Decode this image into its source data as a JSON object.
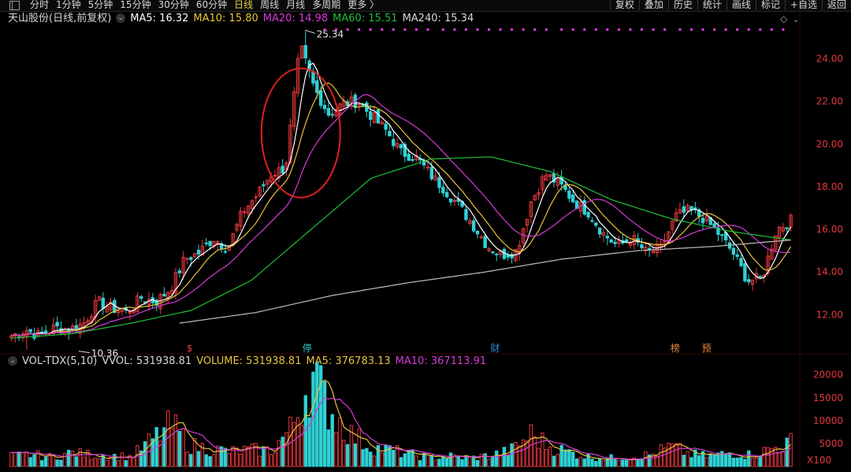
{
  "toolbar": {
    "periods": [
      {
        "label": "分时",
        "active": false
      },
      {
        "label": "1分钟",
        "active": false
      },
      {
        "label": "5分钟",
        "active": false
      },
      {
        "label": "15分钟",
        "active": false
      },
      {
        "label": "30分钟",
        "active": false
      },
      {
        "label": "60分钟",
        "active": false
      },
      {
        "label": "日线",
        "active": true
      },
      {
        "label": "周线",
        "active": false
      },
      {
        "label": "月线",
        "active": false
      },
      {
        "label": "多周期",
        "active": false
      },
      {
        "label": "更多 〉",
        "active": false
      }
    ],
    "right": [
      "复权",
      "叠加",
      "历史",
      "统计",
      "画线",
      "标记",
      "+自选",
      "返回"
    ]
  },
  "ma_info": {
    "name": "天山股份(日线,前复权)",
    "ma5": "MA5: 16.32",
    "ma10": "MA10: 15.80",
    "ma20": "MA20: 14.98",
    "ma60": "MA60: 15.51",
    "ma240": "MA240: 15.34"
  },
  "vol_info": {
    "name": "VOL-TDX(5,10)",
    "vvol": "VVOL: 531938.81",
    "volume": "VOLUME: 531938.81",
    "ma5": "MA5: 376783.13",
    "ma10": "MA10: 367113.91"
  },
  "colors": {
    "up": "#e8383d",
    "down": "#2fd1d4",
    "ma5": "#ffffff",
    "ma10": "#e8c43a",
    "ma20": "#d63ad6",
    "ma60": "#1fbf3a",
    "ma240": "#bdbdbd",
    "axis_text": "#e8383d",
    "annotation": "#e02020"
  },
  "chart_data": [
    {
      "type": "candlestick",
      "title": "天山股份(日线,前复权)",
      "yticks": [
        12.0,
        14.0,
        16.0,
        18.0,
        20.0,
        22.0,
        24.0
      ],
      "ylim": [
        10.2,
        25.5
      ],
      "high_label": "25.34",
      "low_label": "10.36",
      "markers": [
        "$",
        "停",
        "财",
        "榜",
        "预"
      ],
      "close_anchors": [
        11.0,
        11.3,
        11.0,
        11.4,
        11.3,
        11.6,
        12.6,
        12.3,
        12.1,
        12.8,
        12.6,
        13.2,
        14.6,
        14.9,
        15.6,
        15.1,
        16.8,
        17.6,
        18.6,
        18.9,
        24.6,
        22.6,
        21.4,
        21.9,
        22.0,
        21.3,
        20.6,
        19.6,
        19.4,
        18.6,
        17.9,
        17.1,
        16.2,
        15.2,
        14.8,
        15.0,
        17.3,
        18.6,
        18.1,
        17.3,
        16.8,
        15.8,
        15.2,
        15.6,
        14.9,
        15.1,
        16.6,
        16.9,
        16.5,
        15.8,
        14.9,
        13.6,
        13.7,
        16.0,
        16.4
      ],
      "ma_anchors": {
        "MA60": [
          10.9,
          11.1,
          11.6,
          12.2,
          13.6,
          16.0,
          18.4,
          19.3,
          19.4,
          18.7,
          17.4,
          16.5,
          15.9,
          15.5
        ],
        "MA240": [
          11.6,
          12.1,
          12.9,
          13.5,
          14.0,
          14.6,
          15.0,
          15.2,
          15.5
        ]
      },
      "volume": {
        "yticks": [
          5000,
          10000,
          15000,
          20000
        ],
        "unit": "X100",
        "anchors": [
          2200,
          2600,
          2000,
          3000,
          2500,
          2300,
          2100,
          5600,
          9000,
          4500,
          3800,
          3200,
          3600,
          3500,
          8200,
          20000,
          12000,
          7000,
          4200,
          3500,
          2500,
          2000,
          2200,
          1800,
          2400,
          3400,
          7000,
          4200,
          3000,
          2000,
          1800,
          2200,
          2500,
          4300,
          2600,
          2200,
          3000,
          2500,
          3800,
          5200
        ]
      }
    }
  ]
}
